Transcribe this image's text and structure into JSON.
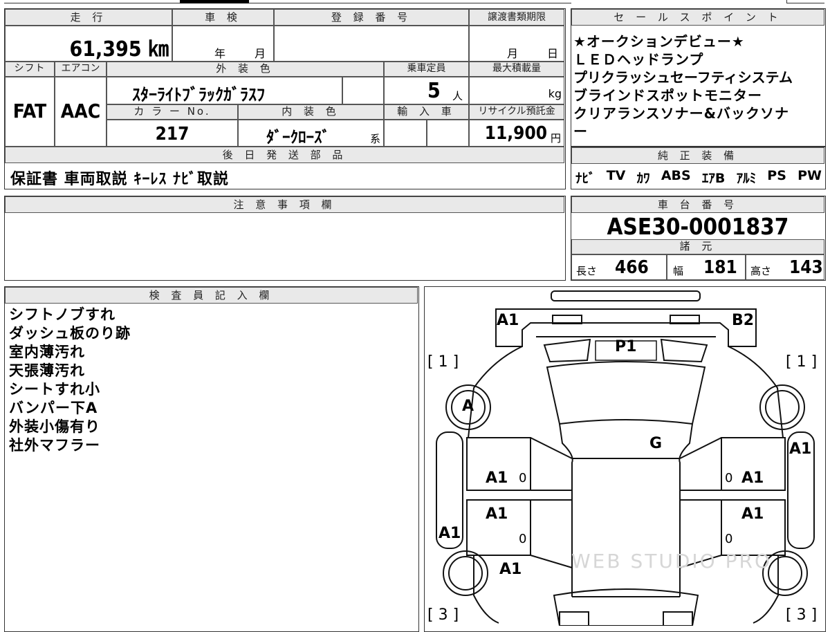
{
  "vehicle": {
    "mileage_header": "走 行",
    "mileage": "61,395 ㎞",
    "inspection_header": "車 検",
    "inspection_year": "年",
    "inspection_month": "月",
    "registration_header": "登 録 番 号",
    "transfer_header": "譲渡書類期限",
    "transfer_month": "月",
    "transfer_day": "日",
    "shift_header": "シフト",
    "shift": "FAT",
    "aircon_header": "エアコン",
    "aircon": "AAC",
    "exterior_color_header": "外 装 色",
    "exterior_color": "ｽﾀｰﾗｲﾄﾌﾞﾗｯｸｶﾞﾗｽﾌ",
    "capacity_header": "乗車定員",
    "capacity": "5",
    "capacity_unit": "人",
    "max_load_header": "最大積載量",
    "max_load_unit": "kg",
    "color_no_header": "カ ラ ー No.",
    "color_no": "217",
    "interior_color_header": "内 装 色",
    "interior_color": "ﾀﾞｰｸﾛｰｽﾞ",
    "interior_suffix": "系",
    "import_header": "輸 入 車",
    "recycle_header": "リサイクル預託金",
    "recycle_fee": "11,900",
    "recycle_unit": "円",
    "later_parts_header": "後 日 発 送 部 品",
    "later_parts": "保証書 車両取説 ｷｰﾚｽ ﾅﾋﾞ取説"
  },
  "sales_points": {
    "header": "セ ー ル ス ポ イ ン ト",
    "lines": [
      "★オークションデビュー★",
      "ＬＥＤヘッドランプ",
      "プリクラッシュセーフティシステム",
      "ブラインドスポットモニター",
      "クリアランスソナー&バックソナ",
      "ー"
    ]
  },
  "genuine_equipment": {
    "header": "純 正 装 備",
    "items": [
      "ﾅﾋﾞ",
      "TV",
      "ｶﾜ",
      "ABS",
      "ｴｱB",
      "ｱﾙﾐ",
      "PS",
      "PW"
    ]
  },
  "notes": {
    "header": "注 意 事 項 欄"
  },
  "chassis": {
    "header": "車 台 番 号",
    "number": "ASE30-0001837"
  },
  "specs": {
    "header": "諸 元",
    "length_label": "長さ",
    "length": "466",
    "width_label": "幅",
    "width": "181",
    "height_label": "高さ",
    "height": "143"
  },
  "inspector": {
    "header": "検 査 員 記 入 欄",
    "lines": [
      "シフトノブすれ",
      "ダッシュ板のり跡",
      "室内薄汚れ",
      "天張薄汚れ",
      "シートすれ小",
      "バンパー下A",
      "外装小傷有り",
      "社外マフラー"
    ]
  },
  "diagram": {
    "marks": {
      "front_left": "A1",
      "front_right": "B2",
      "hood": "P1",
      "windshield": "G",
      "wheel_fl": "A",
      "left_side": "A1",
      "right_side": "A1",
      "front_door_left": "A1",
      "front_door_right": "A1",
      "rear_door_left": "A1",
      "rear_door_right": "A1",
      "rear_left": "A1"
    },
    "brackets": {
      "top_left": "[ 1 ]",
      "top_right": "[ 1 ]",
      "bottom_left": "[ 3 ]",
      "bottom_right": "[ 3 ]"
    },
    "zeros": [
      "0",
      "0",
      "0",
      "0"
    ],
    "watermark": "WEB STUDIO PRO"
  }
}
